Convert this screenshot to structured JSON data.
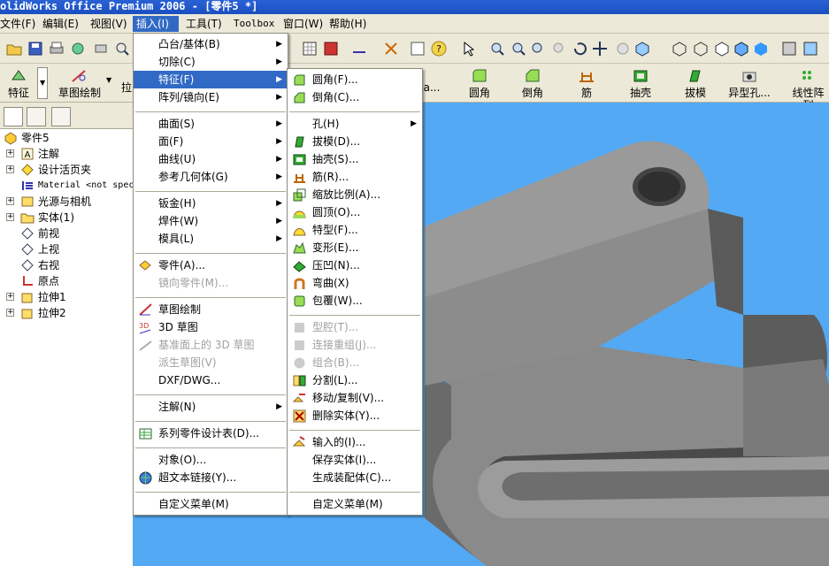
{
  "window": {
    "title": "olidWorks Office Premium 2006 - [零件5 *]"
  },
  "menubar": [
    {
      "label": "文件(F)"
    },
    {
      "label": "编辑(E)"
    },
    {
      "label": "视图(V)"
    },
    {
      "label": "插入(I)"
    },
    {
      "label": "工具(T)"
    },
    {
      "label": "Toolbox"
    },
    {
      "label": "窗口(W)"
    },
    {
      "label": "帮助(H)"
    }
  ],
  "features_toolbar": {
    "left_items": [
      {
        "label": "特征"
      },
      {
        "label": "草图绘制"
      },
      {
        "label": "拉"
      }
    ],
    "hidden_item": "a...",
    "right_items": [
      {
        "label": "圆角"
      },
      {
        "label": "倒角"
      },
      {
        "label": "筋"
      },
      {
        "label": "抽壳"
      },
      {
        "label": "拔模"
      },
      {
        "label": "异型孔..."
      },
      {
        "label": "线性阵列"
      }
    ]
  },
  "tree": {
    "items": [
      {
        "label": "零件5"
      },
      {
        "label": "注解"
      },
      {
        "label": "设计活页夹"
      },
      {
        "label": "Material <not specified>"
      },
      {
        "label": "光源与相机"
      },
      {
        "label": "实体(1)"
      },
      {
        "label": "前视"
      },
      {
        "label": "上视"
      },
      {
        "label": "右视"
      },
      {
        "label": "原点"
      },
      {
        "label": "拉伸1"
      },
      {
        "label": "拉伸2"
      }
    ]
  },
  "insert_menu": {
    "items": [
      {
        "label": "凸台/基体(B)"
      },
      {
        "label": "切除(C)"
      },
      {
        "label": "特征(F)"
      },
      {
        "label": "阵列/镜向(E)"
      },
      {
        "label": "曲面(S)"
      },
      {
        "label": "面(F)"
      },
      {
        "label": "曲线(U)"
      },
      {
        "label": "参考几何体(G)"
      },
      {
        "label": "钣金(H)"
      },
      {
        "label": "焊件(W)"
      },
      {
        "label": "模具(L)"
      },
      {
        "label": "零件(A)..."
      },
      {
        "label": "镜向零件(M)..."
      },
      {
        "label": "草图绘制"
      },
      {
        "label": "3D 草图"
      },
      {
        "label": "基准面上的 3D 草图"
      },
      {
        "label": "派生草图(V)"
      },
      {
        "label": "DXF/DWG..."
      },
      {
        "label": "注解(N)"
      },
      {
        "label": "系列零件设计表(D)..."
      },
      {
        "label": "对象(O)..."
      },
      {
        "label": "超文本链接(Y)..."
      },
      {
        "label": "自定义菜单(M)"
      }
    ]
  },
  "feature_submenu": {
    "items": [
      {
        "label": "圆角(F)..."
      },
      {
        "label": "倒角(C)..."
      },
      {
        "label": "孔(H)"
      },
      {
        "label": "拔模(D)..."
      },
      {
        "label": "抽壳(S)..."
      },
      {
        "label": "筋(R)..."
      },
      {
        "label": "缩放比例(A)..."
      },
      {
        "label": "圆顶(O)..."
      },
      {
        "label": "特型(F)..."
      },
      {
        "label": "变形(E)..."
      },
      {
        "label": "压凹(N)..."
      },
      {
        "label": "弯曲(X)"
      },
      {
        "label": "包覆(W)..."
      },
      {
        "label": "型腔(T)..."
      },
      {
        "label": "连接重组(J)..."
      },
      {
        "label": "组合(B)..."
      },
      {
        "label": "分割(L)..."
      },
      {
        "label": "移动/复制(V)..."
      },
      {
        "label": "删除实体(Y)..."
      },
      {
        "label": "输入的(I)..."
      },
      {
        "label": "保存实体(I)..."
      },
      {
        "label": "生成装配体(C)..."
      },
      {
        "label": "自定义菜单(M)"
      }
    ]
  },
  "colors": {
    "viewport_bg": "#53a9f3",
    "highlight": "#316ac5",
    "menu_bg": "#ffffff",
    "chrome": "#ece9d8"
  }
}
